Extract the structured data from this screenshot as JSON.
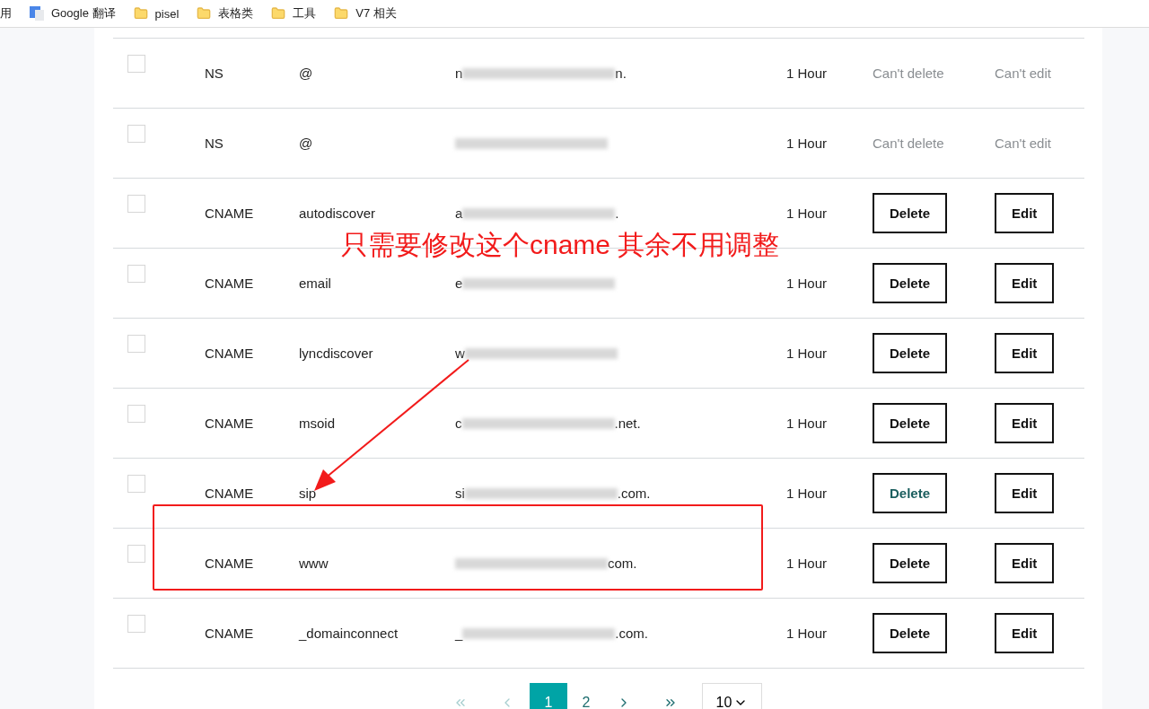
{
  "bookmarks": [
    {
      "kind": "text",
      "label": "用"
    },
    {
      "kind": "translate",
      "label": "Google 翻译"
    },
    {
      "kind": "folder",
      "label": "pisel"
    },
    {
      "kind": "folder",
      "label": "表格类"
    },
    {
      "kind": "folder",
      "label": "工具"
    },
    {
      "kind": "folder",
      "label": "V7 相关"
    }
  ],
  "records": [
    {
      "kind": "locked",
      "checked": false,
      "type": "NS",
      "name": "@",
      "value_start": "n",
      "value_end": "n.",
      "ttl": "1 Hour",
      "delete": "Can't delete",
      "edit": "Can't edit"
    },
    {
      "kind": "locked",
      "checked": false,
      "type": "NS",
      "name": "@",
      "ttl": "1 Hour",
      "delete": "Can't delete",
      "edit": "Can't edit"
    },
    {
      "kind": "editable",
      "checked": false,
      "type": "CNAME",
      "name": "autodiscover",
      "value_start": "a",
      "value_end": ".",
      "ttl": "1 Hour",
      "delete": "Delete",
      "edit": "Edit",
      "delete_hovered": false
    },
    {
      "kind": "editable",
      "checked": false,
      "type": "CNAME",
      "name": "email",
      "value_start": "e",
      "ttl": "1 Hour",
      "delete": "Delete",
      "edit": "Edit",
      "delete_hovered": false
    },
    {
      "kind": "editable",
      "checked": false,
      "type": "CNAME",
      "name": "lyncdiscover",
      "value_start": "w",
      "ttl": "1 Hour",
      "delete": "Delete",
      "edit": "Edit",
      "delete_hovered": false
    },
    {
      "kind": "editable",
      "checked": false,
      "type": "CNAME",
      "name": "msoid",
      "value_start": "c",
      "value_end": ".net.",
      "ttl": "1 Hour",
      "delete": "Delete",
      "edit": "Edit",
      "delete_hovered": false
    },
    {
      "kind": "editable",
      "checked": false,
      "type": "CNAME",
      "name": "sip",
      "value_start": "si",
      "value_end": ".com.",
      "ttl": "1 Hour",
      "delete": "Delete",
      "edit": "Edit",
      "delete_hovered": true
    },
    {
      "kind": "editable",
      "checked": false,
      "type": "CNAME",
      "name": "www",
      "value_end": "com.",
      "ttl": "1 Hour",
      "delete": "Delete",
      "edit": "Edit",
      "delete_hovered": false
    },
    {
      "kind": "editable",
      "checked": false,
      "type": "CNAME",
      "name": "_domainconnect",
      "value_start": "_",
      "value_end": ".com.",
      "ttl": "1 Hour",
      "delete": "Delete",
      "edit": "Edit",
      "delete_hovered": false
    }
  ],
  "annotation": {
    "text": "只需要修改这个cname 其余不用调整"
  },
  "pagination": {
    "pages": [
      {
        "label": "1",
        "selected": true
      },
      {
        "label": "2",
        "selected": false
      }
    ],
    "first_disabled": true,
    "prev_disabled": true,
    "page_size": "10"
  }
}
